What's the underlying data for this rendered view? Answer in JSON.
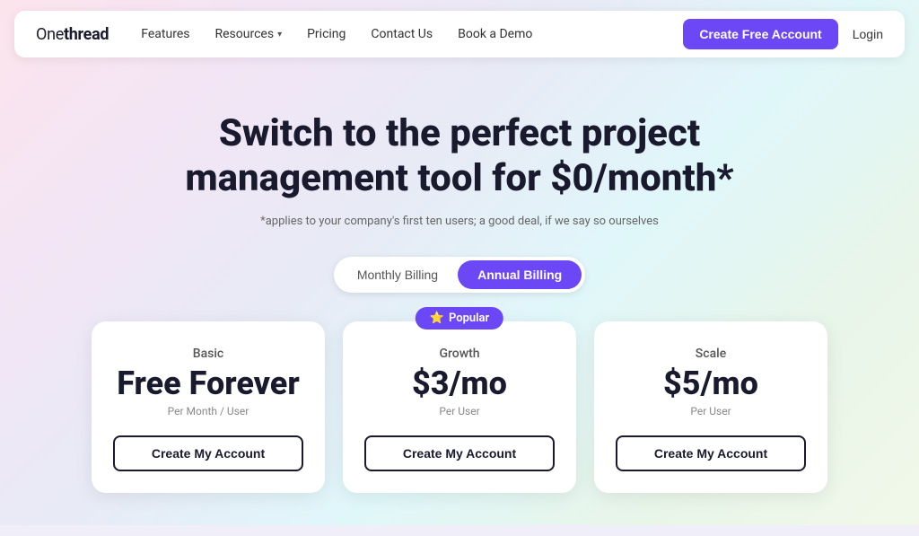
{
  "nav": {
    "logo_part1": "One",
    "logo_part2": "thread",
    "links": [
      {
        "label": "Features",
        "has_dropdown": false
      },
      {
        "label": "Resources",
        "has_dropdown": true
      },
      {
        "label": "Pricing",
        "has_dropdown": false
      },
      {
        "label": "Contact Us",
        "has_dropdown": false
      },
      {
        "label": "Book a Demo",
        "has_dropdown": false
      }
    ],
    "cta_label": "Create Free Account",
    "login_label": "Login"
  },
  "hero": {
    "title": "Switch to the perfect project management tool for $0/month*",
    "subtitle": "*applies to your company's first ten users; a good deal, if we say so ourselves"
  },
  "billing": {
    "monthly_label": "Monthly Billing",
    "annual_label": "Annual Billing",
    "active": "annual"
  },
  "plans": [
    {
      "id": "basic",
      "plan_label": "Basic",
      "price": "Free Forever",
      "price_sub": "Per Month / User",
      "cta": "Create My Account",
      "popular": false
    },
    {
      "id": "growth",
      "plan_label": "Growth",
      "price": "$3/mo",
      "price_sub": "Per User",
      "cta": "Create My Account",
      "popular": true,
      "badge": "Popular",
      "badge_icon": "⭐"
    },
    {
      "id": "scale",
      "plan_label": "Scale",
      "price": "$5/mo",
      "price_sub": "Per User",
      "cta": "Create My Account",
      "popular": false
    }
  ],
  "colors": {
    "accent": "#6c47f5"
  }
}
